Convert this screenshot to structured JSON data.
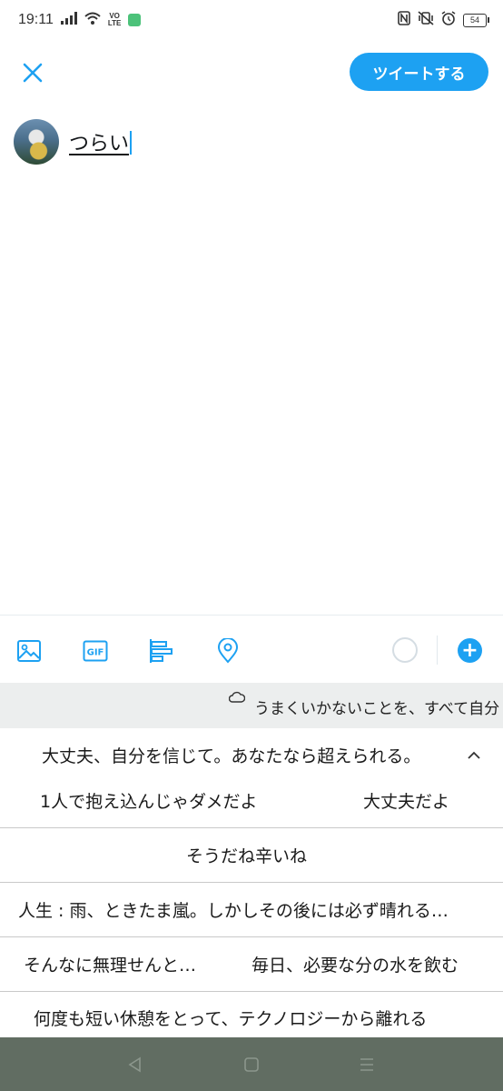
{
  "status_bar": {
    "time": "19:11",
    "volte_top": "VO",
    "volte_bottom": "LTE",
    "battery": "54",
    "icons": [
      "signal-icon",
      "wifi-icon",
      "nfc-icon",
      "vibrate-icon",
      "alarm-icon"
    ]
  },
  "compose": {
    "tweet_button_label": "ツイートする",
    "text": "つらい"
  },
  "toolbar": {
    "icons": [
      "image-icon",
      "gif-icon",
      "poll-icon",
      "location-icon"
    ],
    "gif_label": "GIF",
    "add_label": "+"
  },
  "keyboard": {
    "cloud_suggestion": "うまくいかないことを、すべて自分",
    "candidate_rows": [
      [
        "大丈夫、自分を信じて。あなたなら超えられる。"
      ],
      [
        "1人で抱え込んじゃダメだよ",
        "大丈夫だよ"
      ],
      [
        "そうだね辛いね"
      ],
      [
        "人生 : 雨、ときたま嵐。しかしその後には必ず晴れる…"
      ],
      [
        "そんなに無理せんと…",
        "毎日、必要な分の水を飲む"
      ],
      [
        "何度も短い休憩をとって、テクノロジーから離れる"
      ]
    ]
  },
  "nav_bar": {
    "icons": [
      "back-icon",
      "home-icon",
      "recents-icon"
    ]
  },
  "colors": {
    "accent": "#1da1f2",
    "nav_bar": "#616d62",
    "suggestion_strip": "#eceeee"
  }
}
